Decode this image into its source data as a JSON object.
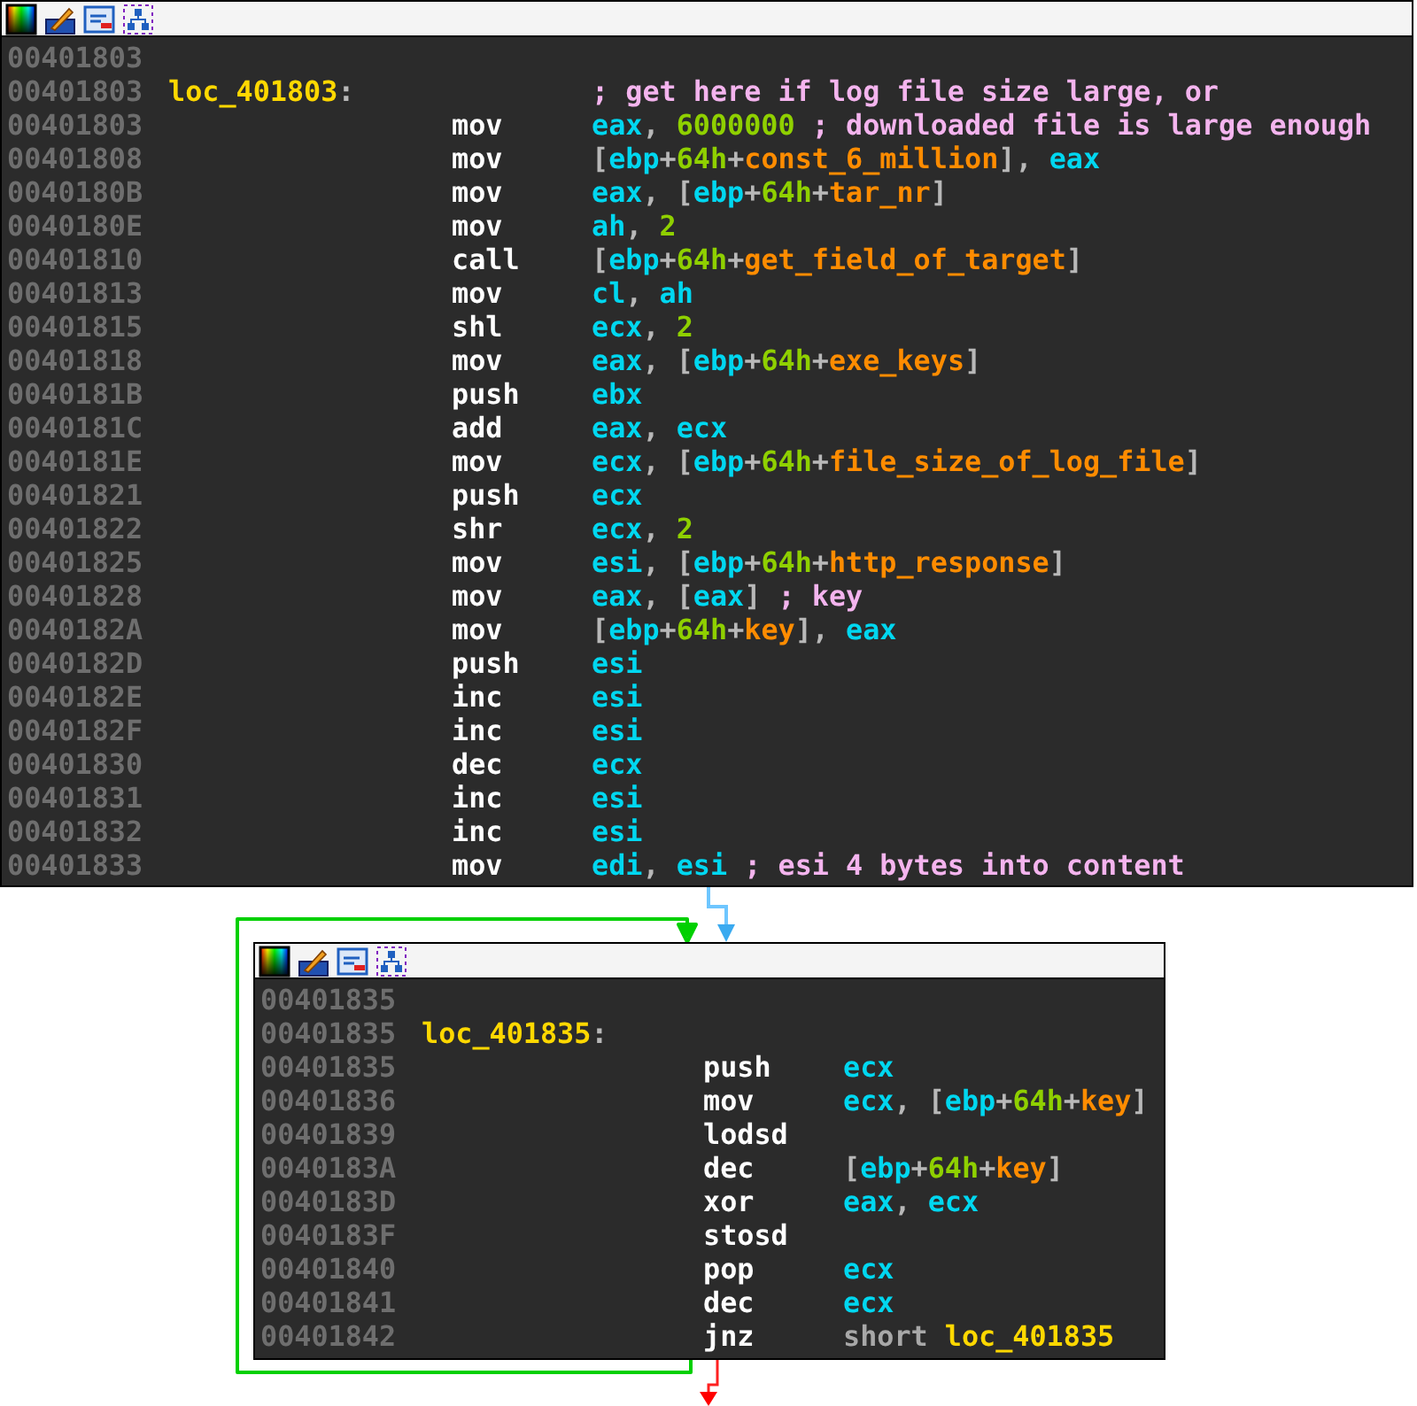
{
  "blocks": [
    {
      "lines": [
        {
          "address": "00401803"
        },
        {
          "address": "00401803",
          "label": "loc_401803",
          "label_suffix": ":",
          "comment": "; get here if log file size large, or"
        },
        {
          "address": "00401803",
          "mnemonic": "mov",
          "operands": [
            {
              "text": "eax",
              "kind": "reg"
            },
            {
              "text": ", ",
              "kind": "punct"
            },
            {
              "text": "6000000",
              "kind": "num"
            }
          ],
          "comment": " ; downloaded file is large enough"
        },
        {
          "address": "00401808",
          "mnemonic": "mov",
          "operands": [
            {
              "text": "[",
              "kind": "punct"
            },
            {
              "text": "ebp",
              "kind": "reg"
            },
            {
              "text": "+",
              "kind": "punct"
            },
            {
              "text": "64h",
              "kind": "num"
            },
            {
              "text": "+",
              "kind": "punct"
            },
            {
              "text": "const_6_million",
              "kind": "var"
            },
            {
              "text": "], ",
              "kind": "punct"
            },
            {
              "text": "eax",
              "kind": "reg"
            }
          ]
        },
        {
          "address": "0040180B",
          "mnemonic": "mov",
          "operands": [
            {
              "text": "eax",
              "kind": "reg"
            },
            {
              "text": ", [",
              "kind": "punct"
            },
            {
              "text": "ebp",
              "kind": "reg"
            },
            {
              "text": "+",
              "kind": "punct"
            },
            {
              "text": "64h",
              "kind": "num"
            },
            {
              "text": "+",
              "kind": "punct"
            },
            {
              "text": "tar_nr",
              "kind": "var"
            },
            {
              "text": "]",
              "kind": "punct"
            }
          ]
        },
        {
          "address": "0040180E",
          "mnemonic": "mov",
          "operands": [
            {
              "text": "ah",
              "kind": "reg"
            },
            {
              "text": ", ",
              "kind": "punct"
            },
            {
              "text": "2",
              "kind": "num"
            }
          ]
        },
        {
          "address": "00401810",
          "mnemonic": "call",
          "operands": [
            {
              "text": "[",
              "kind": "punct"
            },
            {
              "text": "ebp",
              "kind": "reg"
            },
            {
              "text": "+",
              "kind": "punct"
            },
            {
              "text": "64h",
              "kind": "num"
            },
            {
              "text": "+",
              "kind": "punct"
            },
            {
              "text": "get_field_of_target",
              "kind": "var"
            },
            {
              "text": "]",
              "kind": "punct"
            }
          ]
        },
        {
          "address": "00401813",
          "mnemonic": "mov",
          "operands": [
            {
              "text": "cl",
              "kind": "reg"
            },
            {
              "text": ", ",
              "kind": "punct"
            },
            {
              "text": "ah",
              "kind": "reg"
            }
          ]
        },
        {
          "address": "00401815",
          "mnemonic": "shl",
          "operands": [
            {
              "text": "ecx",
              "kind": "reg"
            },
            {
              "text": ", ",
              "kind": "punct"
            },
            {
              "text": "2",
              "kind": "num"
            }
          ]
        },
        {
          "address": "00401818",
          "mnemonic": "mov",
          "operands": [
            {
              "text": "eax",
              "kind": "reg"
            },
            {
              "text": ", [",
              "kind": "punct"
            },
            {
              "text": "ebp",
              "kind": "reg"
            },
            {
              "text": "+",
              "kind": "punct"
            },
            {
              "text": "64h",
              "kind": "num"
            },
            {
              "text": "+",
              "kind": "punct"
            },
            {
              "text": "exe_keys",
              "kind": "var"
            },
            {
              "text": "]",
              "kind": "punct"
            }
          ]
        },
        {
          "address": "0040181B",
          "mnemonic": "push",
          "operands": [
            {
              "text": "ebx",
              "kind": "reg"
            }
          ]
        },
        {
          "address": "0040181C",
          "mnemonic": "add",
          "operands": [
            {
              "text": "eax",
              "kind": "reg"
            },
            {
              "text": ", ",
              "kind": "punct"
            },
            {
              "text": "ecx",
              "kind": "reg"
            }
          ]
        },
        {
          "address": "0040181E",
          "mnemonic": "mov",
          "operands": [
            {
              "text": "ecx",
              "kind": "reg"
            },
            {
              "text": ", [",
              "kind": "punct"
            },
            {
              "text": "ebp",
              "kind": "reg"
            },
            {
              "text": "+",
              "kind": "punct"
            },
            {
              "text": "64h",
              "kind": "num"
            },
            {
              "text": "+",
              "kind": "punct"
            },
            {
              "text": "file_size_of_log_file",
              "kind": "var"
            },
            {
              "text": "]",
              "kind": "punct"
            }
          ]
        },
        {
          "address": "00401821",
          "mnemonic": "push",
          "operands": [
            {
              "text": "ecx",
              "kind": "reg"
            }
          ]
        },
        {
          "address": "00401822",
          "mnemonic": "shr",
          "operands": [
            {
              "text": "ecx",
              "kind": "reg"
            },
            {
              "text": ", ",
              "kind": "punct"
            },
            {
              "text": "2",
              "kind": "num"
            }
          ]
        },
        {
          "address": "00401825",
          "mnemonic": "mov",
          "operands": [
            {
              "text": "esi",
              "kind": "reg"
            },
            {
              "text": ", [",
              "kind": "punct"
            },
            {
              "text": "ebp",
              "kind": "reg"
            },
            {
              "text": "+",
              "kind": "punct"
            },
            {
              "text": "64h",
              "kind": "num"
            },
            {
              "text": "+",
              "kind": "punct"
            },
            {
              "text": "http_response",
              "kind": "var"
            },
            {
              "text": "]",
              "kind": "punct"
            }
          ]
        },
        {
          "address": "00401828",
          "mnemonic": "mov",
          "operands": [
            {
              "text": "eax",
              "kind": "reg"
            },
            {
              "text": ", [",
              "kind": "punct"
            },
            {
              "text": "eax",
              "kind": "reg"
            },
            {
              "text": "]",
              "kind": "punct"
            }
          ],
          "comment": " ; key"
        },
        {
          "address": "0040182A",
          "mnemonic": "mov",
          "operands": [
            {
              "text": "[",
              "kind": "punct"
            },
            {
              "text": "ebp",
              "kind": "reg"
            },
            {
              "text": "+",
              "kind": "punct"
            },
            {
              "text": "64h",
              "kind": "num"
            },
            {
              "text": "+",
              "kind": "punct"
            },
            {
              "text": "key",
              "kind": "var"
            },
            {
              "text": "], ",
              "kind": "punct"
            },
            {
              "text": "eax",
              "kind": "reg"
            }
          ]
        },
        {
          "address": "0040182D",
          "mnemonic": "push",
          "operands": [
            {
              "text": "esi",
              "kind": "reg"
            }
          ]
        },
        {
          "address": "0040182E",
          "mnemonic": "inc",
          "operands": [
            {
              "text": "esi",
              "kind": "reg"
            }
          ]
        },
        {
          "address": "0040182F",
          "mnemonic": "inc",
          "operands": [
            {
              "text": "esi",
              "kind": "reg"
            }
          ]
        },
        {
          "address": "00401830",
          "mnemonic": "dec",
          "operands": [
            {
              "text": "ecx",
              "kind": "reg"
            }
          ]
        },
        {
          "address": "00401831",
          "mnemonic": "inc",
          "operands": [
            {
              "text": "esi",
              "kind": "reg"
            }
          ]
        },
        {
          "address": "00401832",
          "mnemonic": "inc",
          "operands": [
            {
              "text": "esi",
              "kind": "reg"
            }
          ]
        },
        {
          "address": "00401833",
          "mnemonic": "mov",
          "operands": [
            {
              "text": "edi",
              "kind": "reg"
            },
            {
              "text": ", ",
              "kind": "punct"
            },
            {
              "text": "esi",
              "kind": "reg"
            }
          ],
          "comment": " ; esi 4 bytes into content"
        }
      ]
    },
    {
      "lines": [
        {
          "address": "00401835"
        },
        {
          "address": "00401835",
          "label": "loc_401835",
          "label_suffix": ":"
        },
        {
          "address": "00401835",
          "mnemonic": "push",
          "operands": [
            {
              "text": "ecx",
              "kind": "reg"
            }
          ]
        },
        {
          "address": "00401836",
          "mnemonic": "mov",
          "operands": [
            {
              "text": "ecx",
              "kind": "reg"
            },
            {
              "text": ", [",
              "kind": "punct"
            },
            {
              "text": "ebp",
              "kind": "reg"
            },
            {
              "text": "+",
              "kind": "punct"
            },
            {
              "text": "64h",
              "kind": "num"
            },
            {
              "text": "+",
              "kind": "punct"
            },
            {
              "text": "key",
              "kind": "var"
            },
            {
              "text": "]",
              "kind": "punct"
            }
          ]
        },
        {
          "address": "00401839",
          "mnemonic": "lodsd"
        },
        {
          "address": "0040183A",
          "mnemonic": "dec",
          "operands": [
            {
              "text": "[",
              "kind": "punct"
            },
            {
              "text": "ebp",
              "kind": "reg"
            },
            {
              "text": "+",
              "kind": "punct"
            },
            {
              "text": "64h",
              "kind": "num"
            },
            {
              "text": "+",
              "kind": "punct"
            },
            {
              "text": "key",
              "kind": "var"
            },
            {
              "text": "]",
              "kind": "punct"
            }
          ]
        },
        {
          "address": "0040183D",
          "mnemonic": "xor",
          "operands": [
            {
              "text": "eax",
              "kind": "reg"
            },
            {
              "text": ", ",
              "kind": "punct"
            },
            {
              "text": "ecx",
              "kind": "reg"
            }
          ]
        },
        {
          "address": "0040183F",
          "mnemonic": "stosd"
        },
        {
          "address": "00401840",
          "mnemonic": "pop",
          "operands": [
            {
              "text": "ecx",
              "kind": "reg"
            }
          ]
        },
        {
          "address": "00401841",
          "mnemonic": "dec",
          "operands": [
            {
              "text": "ecx",
              "kind": "reg"
            }
          ]
        },
        {
          "address": "00401842",
          "mnemonic": "jnz",
          "operands": [
            {
              "text": "short ",
              "kind": "keyword"
            },
            {
              "text": "loc_401835",
              "kind": "label"
            }
          ]
        }
      ]
    }
  ]
}
